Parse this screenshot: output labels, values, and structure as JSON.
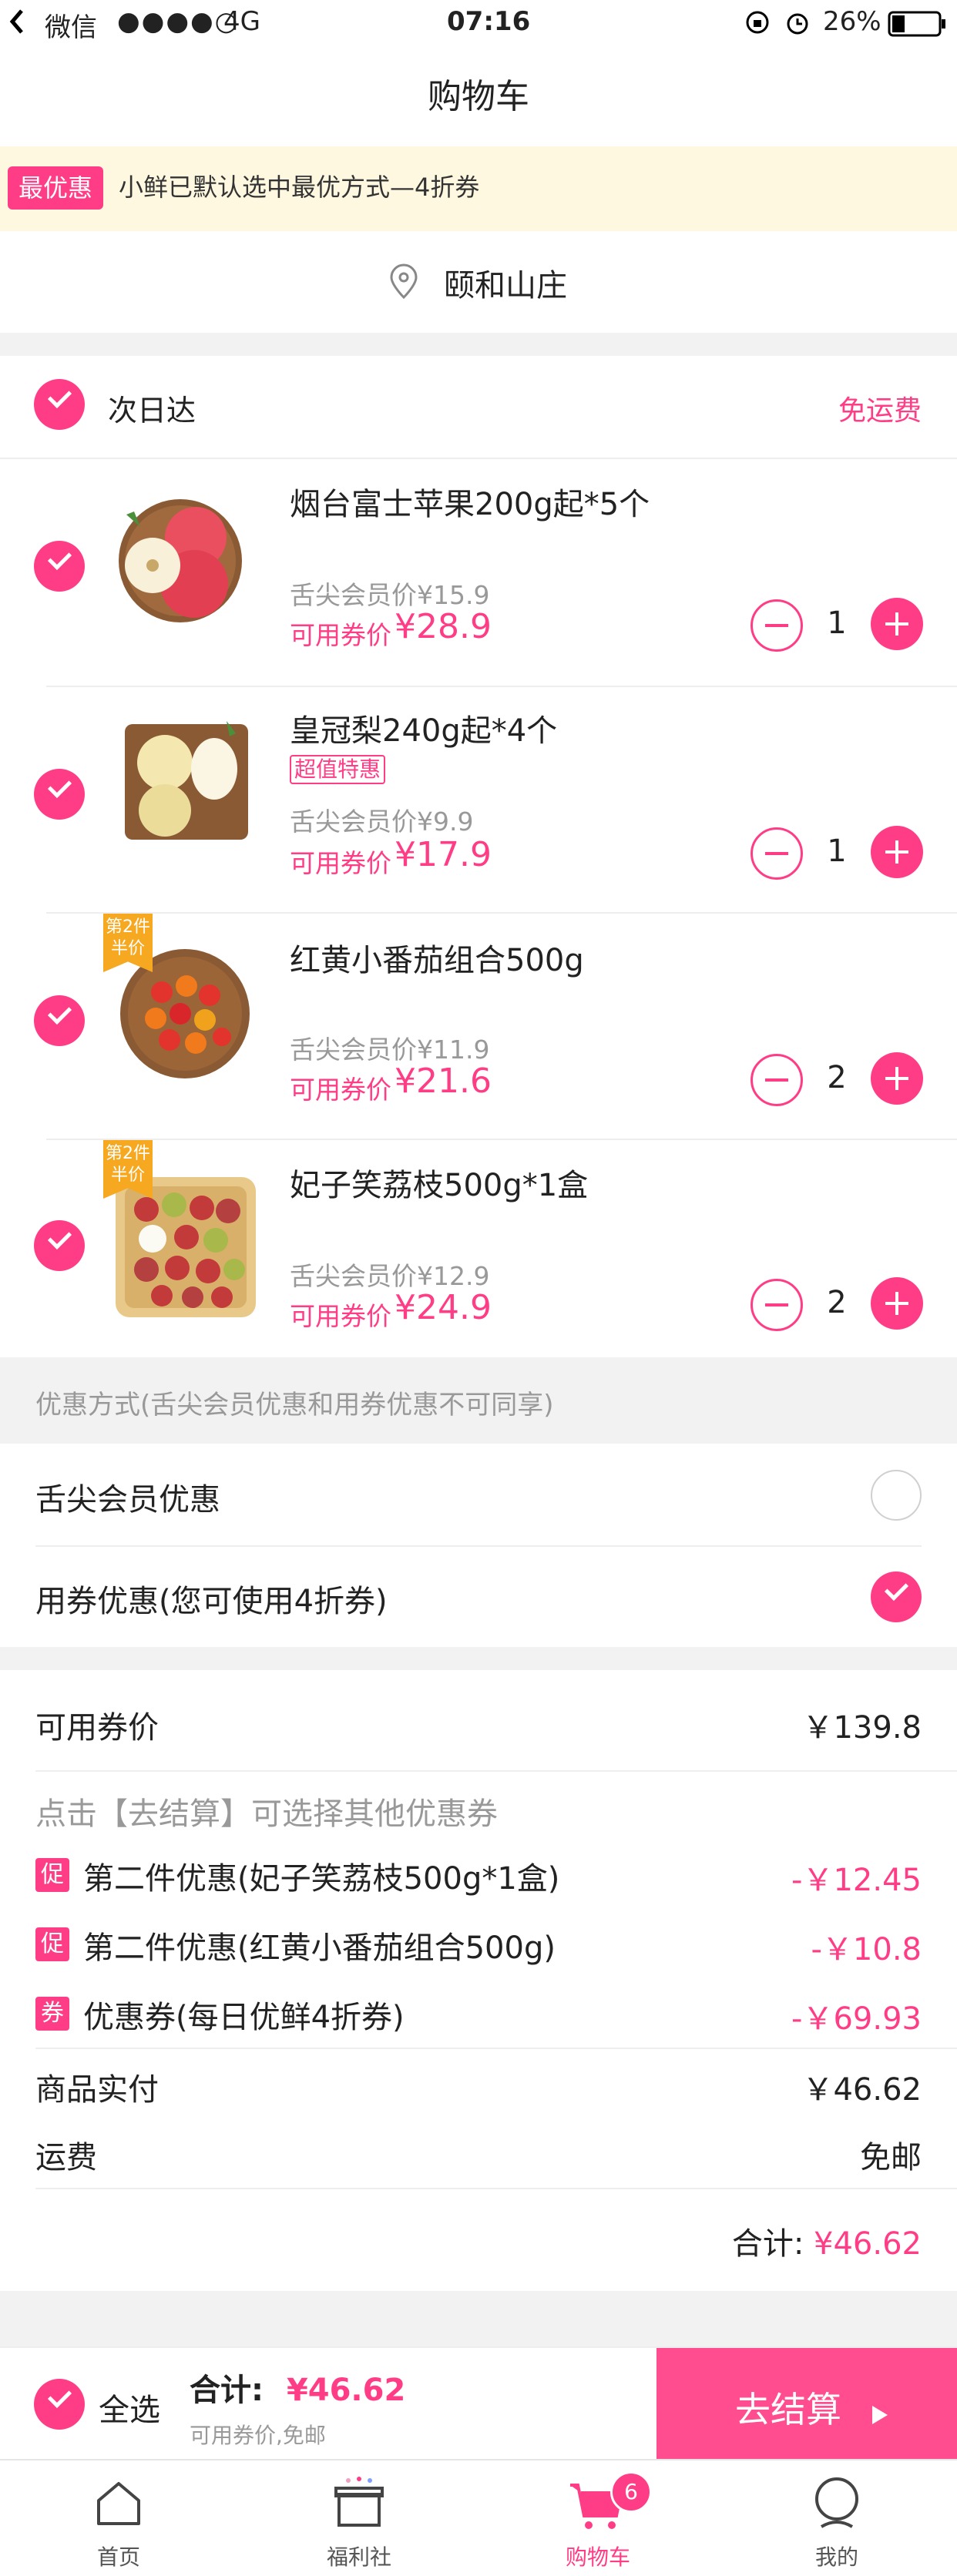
{
  "status_bar": {
    "back_app": "微信",
    "signal": "●●●●○",
    "network": "4G",
    "time": "07:16",
    "battery": "26%"
  },
  "nav": {
    "title": "购物车"
  },
  "notice": {
    "tag": "最优惠",
    "text": "小鲜已默认选中最优方式—4折券"
  },
  "address": {
    "text": "颐和山庄"
  },
  "group": {
    "title": "次日达",
    "shipping_note": "免运费"
  },
  "products": [
    {
      "name": "烟台富士苹果200g起*5个",
      "special_tag": "",
      "member_price": "舌尖会员价¥15.9",
      "coupon_label": "可用券价",
      "coupon_price": "¥28.9",
      "qty": "1",
      "promo_badge": ""
    },
    {
      "name": "皇冠梨240g起*4个",
      "special_tag": "超值特惠",
      "member_price": "舌尖会员价¥9.9",
      "coupon_label": "可用券价",
      "coupon_price": "¥17.9",
      "qty": "1",
      "promo_badge": ""
    },
    {
      "name": "红黄小番茄组合500g",
      "special_tag": "",
      "member_price": "舌尖会员价¥11.9",
      "coupon_label": "可用券价",
      "coupon_price": "¥21.6",
      "qty": "2",
      "promo_badge": "第2件半价"
    },
    {
      "name": "妃子笑荔枝500g*1盒",
      "special_tag": "",
      "member_price": "舌尖会员价¥12.9",
      "coupon_label": "可用券价",
      "coupon_price": "¥24.9",
      "qty": "2",
      "promo_badge": "第2件半价"
    }
  ],
  "discount_section": {
    "header": "优惠方式(舌尖会员优惠和用券优惠不可同享)",
    "options": [
      {
        "label": "舌尖会员优惠",
        "selected": false
      },
      {
        "label": "用券优惠(您可使用4折券)",
        "selected": true
      }
    ]
  },
  "summary": {
    "coupon_price_label": "可用券价",
    "coupon_price_value": "￥139.8",
    "hint": "点击【去结算】可选择其他优惠券",
    "promos": [
      {
        "tag": "促",
        "label": "第二件优惠(妃子笑荔枝500g*1盒)",
        "value": "-￥12.45"
      },
      {
        "tag": "促",
        "label": "第二件优惠(红黄小番茄组合500g)",
        "value": "-￥10.8"
      },
      {
        "tag": "券",
        "label": "优惠券(每日优鲜4折券)",
        "value": "-￥69.93"
      }
    ],
    "actual_label": "商品实付",
    "actual_value": "￥46.62",
    "shipping_label": "运费",
    "shipping_value": "免邮",
    "total_label": "合计:",
    "total_value": "¥46.62"
  },
  "checkout_bar": {
    "select_all": "全选",
    "total_label": "合计:",
    "total_value": "¥46.62",
    "sub_note": "可用券价,免邮",
    "checkout_label": "去结算"
  },
  "tabbar": {
    "items": [
      {
        "label": "首页",
        "icon": "home-icon"
      },
      {
        "label": "福利社",
        "icon": "gift-icon"
      },
      {
        "label": "购物车",
        "icon": "cart-icon",
        "badge": "6",
        "active": true
      },
      {
        "label": "我的",
        "icon": "profile-icon"
      }
    ]
  },
  "colors": {
    "accent": "#ff3d86",
    "badge_orange": "#f6a821",
    "notice_bg": "#fff8e0"
  }
}
